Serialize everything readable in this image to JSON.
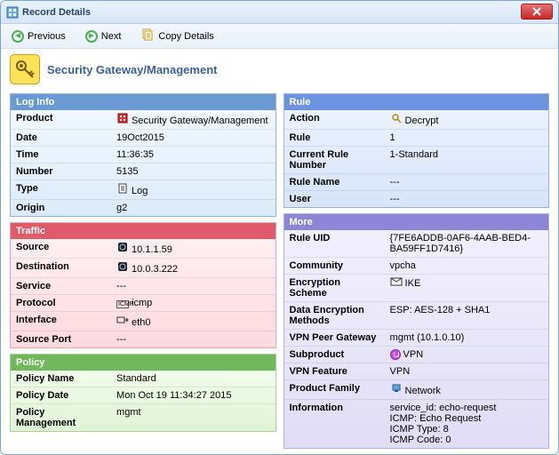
{
  "window": {
    "title": "Record Details"
  },
  "toolbar": {
    "previous": "Previous",
    "next": "Next",
    "copy": "Copy Details"
  },
  "header": {
    "title": "Security Gateway/Management"
  },
  "log_info": {
    "header": "Log Info",
    "rows": [
      {
        "k": "Product",
        "v": "Security Gateway/Management"
      },
      {
        "k": "Date",
        "v": "19Oct2015"
      },
      {
        "k": "Time",
        "v": "11:36:35"
      },
      {
        "k": "Number",
        "v": "5135"
      },
      {
        "k": "Type",
        "v": "Log"
      },
      {
        "k": "Origin",
        "v": "g2"
      }
    ]
  },
  "traffic": {
    "header": "Traffic",
    "rows": [
      {
        "k": "Source",
        "v": "10.1.1.59"
      },
      {
        "k": "Destination",
        "v": "10.0.3.222"
      },
      {
        "k": "Service",
        "v": "---"
      },
      {
        "k": "Protocol",
        "v": "icmp"
      },
      {
        "k": "Interface",
        "v": "eth0"
      },
      {
        "k": "Source Port",
        "v": "---"
      }
    ]
  },
  "policy": {
    "header": "Policy",
    "rows": [
      {
        "k": "Policy Name",
        "v": "Standard"
      },
      {
        "k": "Policy Date",
        "v": "Mon Oct 19 11:34:27 2015"
      },
      {
        "k": "Policy Management",
        "v": "mgmt"
      }
    ]
  },
  "rule": {
    "header": "Rule",
    "rows": [
      {
        "k": "Action",
        "v": "Decrypt"
      },
      {
        "k": "Rule",
        "v": "1"
      },
      {
        "k": "Current Rule Number",
        "v": "1-Standard"
      },
      {
        "k": "Rule Name",
        "v": "---"
      },
      {
        "k": "User",
        "v": "---"
      }
    ]
  },
  "more": {
    "header": "More",
    "rows": [
      {
        "k": "Rule UID",
        "v": "{7FE6ADDB-0AF6-4AAB-BED4-BA59FF1D7416}"
      },
      {
        "k": "Community",
        "v": "vpcha"
      },
      {
        "k": "Encryption Scheme",
        "v": "IKE"
      },
      {
        "k": "Data Encryption Methods",
        "v": "ESP: AES-128 + SHA1"
      },
      {
        "k": "VPN Peer Gateway",
        "v": "mgmt (10.1.0.10)"
      },
      {
        "k": "Subproduct",
        "v": "VPN"
      },
      {
        "k": "VPN Feature",
        "v": "VPN"
      },
      {
        "k": "Product Family",
        "v": "Network"
      },
      {
        "k": "Information",
        "v": "service_id: echo-request\nICMP: Echo Request\nICMP Type: 8\nICMP Code: 0"
      }
    ]
  }
}
